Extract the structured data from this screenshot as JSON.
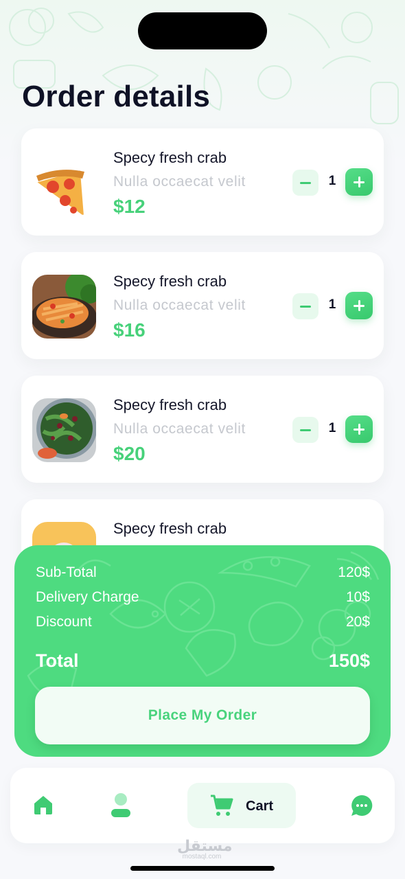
{
  "page": {
    "title": "Order details"
  },
  "items": [
    {
      "name": "Specy fresh crab",
      "description": "Nulla occaecat velit",
      "price": "$12",
      "quantity": "1",
      "image": "pizza-slice"
    },
    {
      "name": "Specy fresh crab",
      "description": "Nulla occaecat velit",
      "price": "$16",
      "quantity": "1",
      "image": "pasta-plate"
    },
    {
      "name": "Specy fresh crab",
      "description": "Nulla occaecat velit",
      "price": "$20",
      "quantity": "1",
      "image": "salad-bowl"
    },
    {
      "name": "Specy fresh crab",
      "description": "",
      "price": "",
      "quantity": "",
      "image": "ice-cream"
    }
  ],
  "summary": {
    "subtotal_label": "Sub-Total",
    "subtotal_value": "120$",
    "delivery_label": "Delivery Charge",
    "delivery_value": "10$",
    "discount_label": "Discount",
    "discount_value": "20$",
    "total_label": "Total",
    "total_value": "150$",
    "order_button": "Place My Order"
  },
  "nav": {
    "items": [
      {
        "icon": "home-icon"
      },
      {
        "icon": "profile-icon"
      },
      {
        "icon": "cart-icon",
        "label": "Cart",
        "active": true
      },
      {
        "icon": "chat-icon"
      }
    ]
  },
  "watermark": {
    "arabic": "مستقل",
    "latin": "mostaql.com"
  },
  "colors": {
    "accent": "#4edb80",
    "price": "#47d17a",
    "text": "#0f1226",
    "muted": "#c5c8ce"
  }
}
